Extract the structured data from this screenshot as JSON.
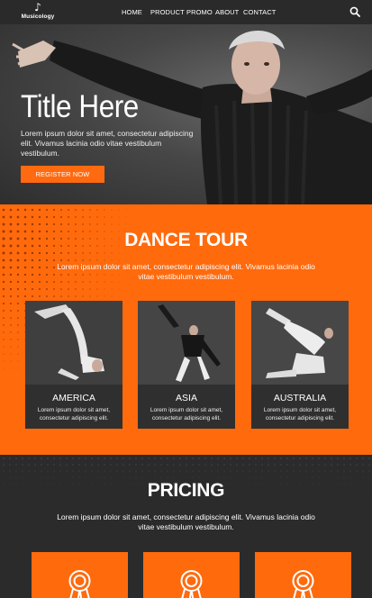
{
  "nav": {
    "logo_text": "Musicology",
    "links": [
      "HOME",
      "PRODUCT",
      "PROMO",
      "ABOUT",
      "CONTACT"
    ]
  },
  "hero": {
    "title": "Title Here",
    "text": "Lorem ipsum dolor sit amet, consectetur adipiscing elit. Vivamus lacinia odio vitae vestibulum vestibulum.",
    "button": "REGISTER NOW"
  },
  "tour": {
    "title": "DANCE TOUR",
    "text": "Lorem ipsum dolor sit amet, consectetur adipiscing elit. Vivamus lacinia odio vitae vestibulum vestibulum.",
    "cards": [
      {
        "name": "AMERICA",
        "desc": "Lorem ipsum dolor sit amet, consectetur adipiscing elit."
      },
      {
        "name": "ASIA",
        "desc": "Lorem ipsum dolor sit amet, consectetur adipiscing elit."
      },
      {
        "name": "AUSTRALIA",
        "desc": "Lorem ipsum dolor sit amet, consectetur adipiscing elit."
      }
    ]
  },
  "pricing": {
    "title": "PRICING",
    "text": "Lorem ipsum dolor sit amet, consectetur adipiscing elit. Vivamus lacinia odio vitae vestibulum vestibulum.",
    "cards": [
      {
        "icon": "award-icon"
      },
      {
        "icon": "award-icon"
      },
      {
        "icon": "award-icon"
      }
    ]
  },
  "colors": {
    "accent": "#ff6a0d",
    "dark": "#2b2b2b",
    "card": "#2f2f2f"
  }
}
